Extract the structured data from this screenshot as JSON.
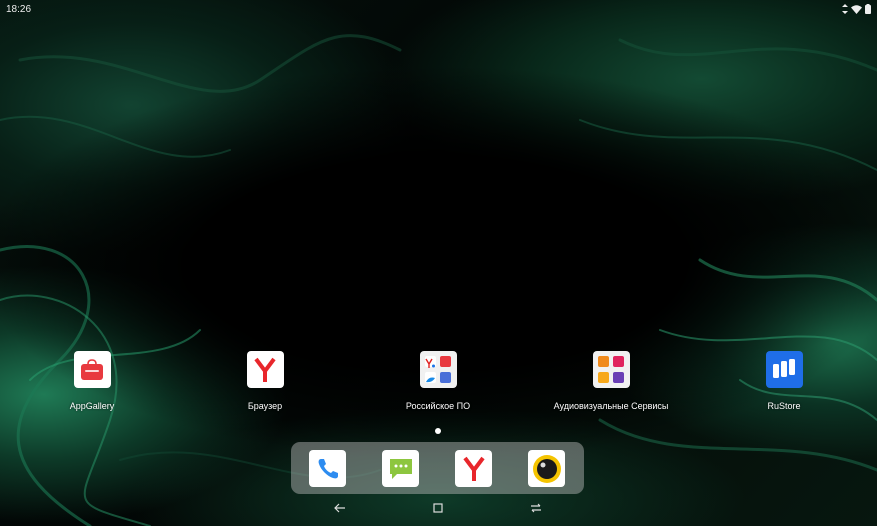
{
  "status_bar": {
    "time": "18:26",
    "icons": [
      "data-arrows-icon",
      "wifi-icon",
      "battery-icon"
    ]
  },
  "home_screen": {
    "apps": [
      {
        "label": "AppGallery",
        "icon": "appgallery-icon",
        "color": "#e8393f"
      },
      {
        "label": "Браузер",
        "icon": "yandex-browser-icon",
        "color": "#e8262b"
      },
      {
        "label": "Российское ПО",
        "icon": "folder-icon"
      },
      {
        "label": "Аудиовизуальные Сервисы",
        "icon": "folder-icon"
      },
      {
        "label": "RuStore",
        "icon": "rustore-icon",
        "color": "#1f6ee8"
      }
    ],
    "current_page": 1
  },
  "dock": {
    "items": [
      {
        "name": "phone",
        "icon": "phone-icon",
        "color": "#2d8cf0"
      },
      {
        "name": "messages",
        "icon": "messages-icon",
        "color": "#8dc63f"
      },
      {
        "name": "browser",
        "icon": "yandex-browser-icon",
        "color": "#e8262b"
      },
      {
        "name": "camera",
        "icon": "camera-icon",
        "color": "#f5c400"
      }
    ]
  },
  "nav_bar": {
    "buttons": [
      "back-icon",
      "home-icon",
      "recents-icon"
    ]
  }
}
